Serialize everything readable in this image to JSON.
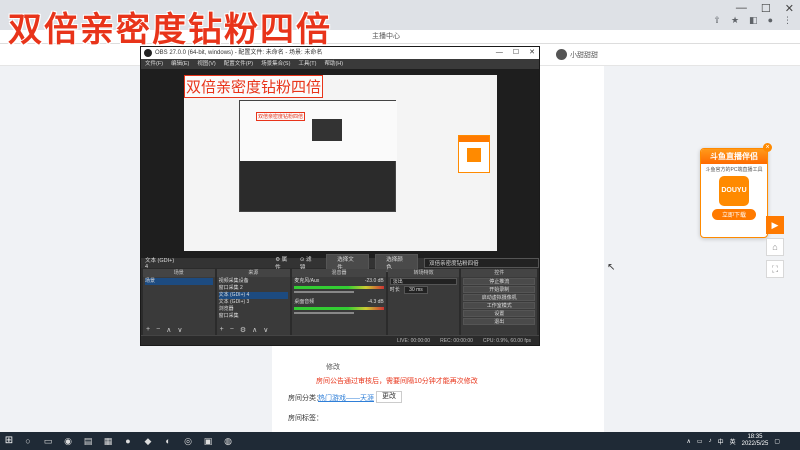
{
  "overlay": {
    "title": "双倍亲密度钻粉四倍"
  },
  "browser": {
    "tab_title": "主播中心",
    "controls": {
      "minimize": "—",
      "maximize": "☐",
      "close": "✕"
    }
  },
  "header": {
    "username": "小甜甜甜"
  },
  "content": {
    "edit_label": "修改",
    "notice": "房间公告通过审核后，需要间隔10分钟才能再次修改",
    "room_category_label": "房间分类：",
    "room_category_value": "热门游戏——天涯",
    "room_category_button": "更改",
    "room_tag_label": "房间标签："
  },
  "promo": {
    "head": "斗鱼直播伴侣",
    "sub": "斗鱼官方的PC端直播工具",
    "logo": "DOUYU",
    "button": "立即下载",
    "close": "×"
  },
  "side_tools": [
    "▶",
    "⌂",
    "⛶"
  ],
  "obs": {
    "title": "OBS 27.0.0 (64-bit, windows) - 配置文件: 未命名 - 场景: 未命名",
    "menu": [
      "文件(F)",
      "编辑(E)",
      "视图(V)",
      "配置文件(P)",
      "场景集合(S)",
      "工具(T)",
      "帮助(H)"
    ],
    "canvas_title": "双倍亲密度钻粉四倍",
    "canvas_sub": "双倍亲密度钻粉四倍",
    "scenebar": {
      "selected": "文本 (GDI+) 4",
      "properties": "⚙ 属性",
      "filters": "⊙ 滤镜",
      "choose_file": "选择文件",
      "choose_color": "选择颜色",
      "text_field": "双倍亲密度钻粉四倍"
    },
    "docks": {
      "scenes": {
        "header": "场景",
        "items": [
          "场景"
        ]
      },
      "sources": {
        "header": "来源",
        "items": [
          "视频采集设备",
          "窗口采集 2",
          "文本 (GDI+) 4",
          "文本 (GDI+) 3",
          "浏览器",
          "窗口采集"
        ]
      },
      "mixer": {
        "header": "混音器",
        "channels": [
          {
            "name": "麦克风/Aux",
            "db": "-23.0 dB"
          },
          {
            "name": "桌面音频",
            "db": "-4.3 dB"
          }
        ]
      },
      "transitions": {
        "header": "转场特效",
        "type": "淡出",
        "duration_label": "时长",
        "duration": "30 ms"
      },
      "controls": {
        "header": "控件",
        "buttons": [
          "停止推流",
          "开始录制",
          "启动虚拟摄像机",
          "工作室模式",
          "设置",
          "退出"
        ]
      }
    },
    "status": {
      "live": "LIVE: 00:00:00",
      "rec": "REC: 00:00:00",
      "cpu": "CPU: 0.9%, 60.00 fps"
    }
  },
  "taskbar": {
    "time": "18:35",
    "date": "2022/5/25",
    "ime": "中",
    "lang": "英"
  }
}
